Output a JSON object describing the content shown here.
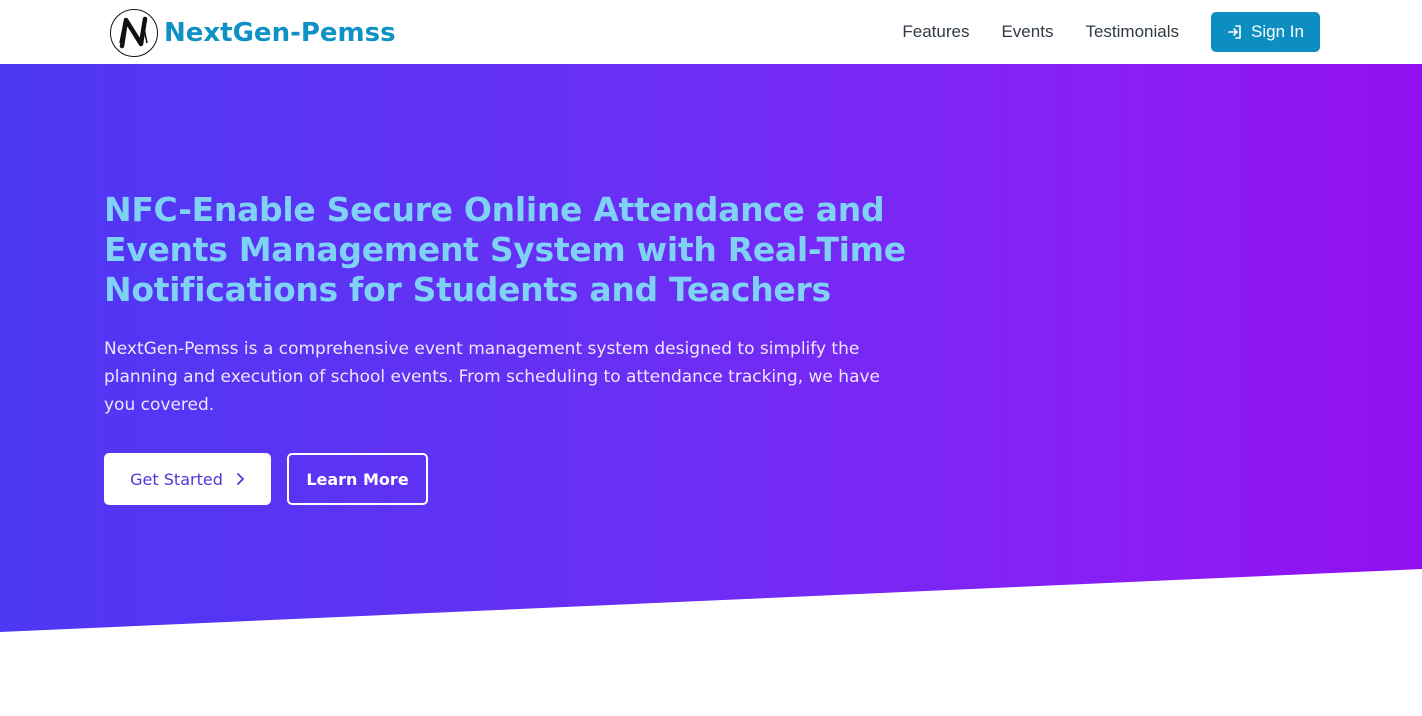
{
  "navbar": {
    "brand_name": "NextGen-Pemss",
    "links": [
      {
        "label": "Features"
      },
      {
        "label": "Events"
      },
      {
        "label": "Testimonials"
      }
    ],
    "signin_label": "Sign In"
  },
  "hero": {
    "title": "NFC-Enable Secure Online Attendance and Events Management System with Real-Time Notifications for Students and Teachers",
    "description": "NextGen-Pemss is a comprehensive event management system designed to simplify the planning and execution of school events. From scheduling to attendance tracking, we have you covered.",
    "primary_button": "Get Started",
    "secondary_button": "Learn More"
  },
  "colors": {
    "brand": "#0e91c4",
    "signin_button": "#0d8ec2",
    "hero_gradient_start": "#4d38f4",
    "hero_gradient_end": "#9210f0",
    "hero_title": "#7fd2f6"
  },
  "icons": {
    "logo": "nfc-n-logo-icon",
    "signin": "sign-in-icon",
    "get_started": "chevron-right-icon"
  }
}
